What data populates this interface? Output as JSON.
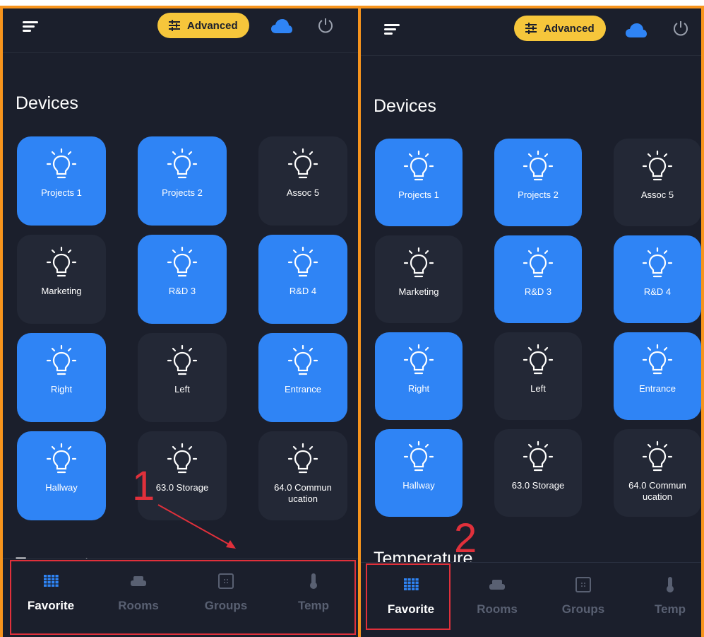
{
  "colors": {
    "background": "#1b1f2c",
    "tile_off": "#232836",
    "tile_on": "#2f84f5",
    "accent_yellow": "#f6c63b",
    "cloud_blue": "#2f84f5",
    "annotation_red": "#e0303b",
    "frame_orange": "#f7941d"
  },
  "header": {
    "advanced_label": "Advanced",
    "icons": [
      "menu-icon",
      "sliders-icon",
      "cloud-icon",
      "power-icon"
    ]
  },
  "devices": {
    "title": "Devices",
    "items": [
      {
        "label": "Projects 1",
        "on": true
      },
      {
        "label": "Projects 2",
        "on": true
      },
      {
        "label": "Assoc 5",
        "on": false
      },
      {
        "label": "Marketing",
        "on": false
      },
      {
        "label": "R&D 3",
        "on": true
      },
      {
        "label": "R&D 4",
        "on": true
      },
      {
        "label": "Right",
        "on": true
      },
      {
        "label": "Left",
        "on": false
      },
      {
        "label": "Entrance",
        "on": true
      },
      {
        "label": "Hallway",
        "on": true
      },
      {
        "label": "63.0 Storage",
        "on": false
      },
      {
        "label": "64.0 Commun ucation",
        "on": false
      }
    ]
  },
  "temperature": {
    "title": "Temperature"
  },
  "nav": {
    "items": [
      {
        "label": "Favorite",
        "icon": "grid-icon",
        "active": true
      },
      {
        "label": "Rooms",
        "icon": "sofa-icon",
        "active": false
      },
      {
        "label": "Groups",
        "icon": "groups-icon",
        "active": false
      },
      {
        "label": "Temp",
        "icon": "thermometer-icon",
        "active": false
      }
    ]
  },
  "annotations": {
    "step1": "1",
    "step2": "2"
  }
}
